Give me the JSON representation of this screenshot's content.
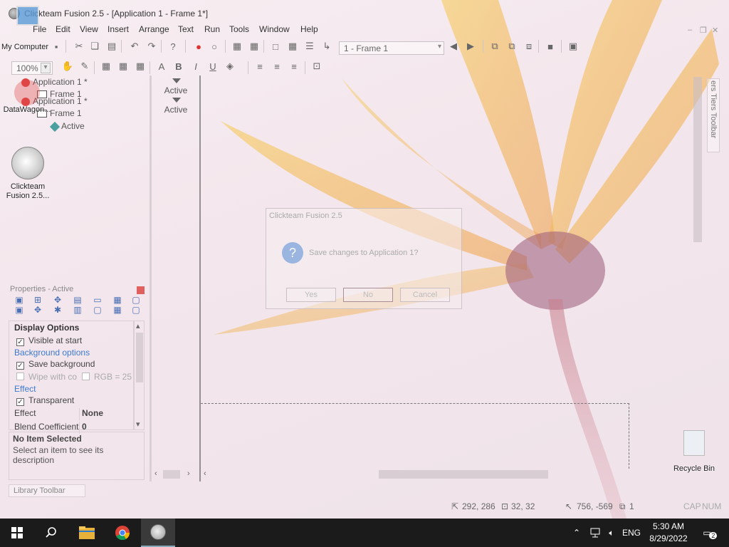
{
  "window": {
    "title": "Clickteam Fusion 2.5 - [Application 1 - Frame 1*]"
  },
  "menu": [
    "File",
    "Edit",
    "View",
    "Insert",
    "Arrange",
    "Text",
    "Run",
    "Tools",
    "Window",
    "Help"
  ],
  "toolbar": {
    "frame_select": "1 - Frame 1",
    "zoom": "100%"
  },
  "workspace_tree": {
    "items": [
      {
        "label": "Application 1 *",
        "type": "app"
      },
      {
        "label": "Frame 1",
        "type": "frame"
      },
      {
        "label": "Application 1 *",
        "type": "app"
      },
      {
        "label": "Frame 1",
        "type": "frame"
      },
      {
        "label": "Active",
        "type": "active"
      }
    ]
  },
  "storyboard": {
    "labels": [
      "Active",
      "Active"
    ]
  },
  "side_tab": "ers Tiers Toolbar",
  "properties": {
    "header": "Properties - Active",
    "rows": [
      {
        "kind": "section",
        "label": "Display Options"
      },
      {
        "kind": "check",
        "label": "Visible at start",
        "checked": true
      },
      {
        "kind": "subsection",
        "label": "Background options"
      },
      {
        "kind": "check",
        "label": "Save background",
        "checked": true
      },
      {
        "kind": "check2",
        "label": "Wipe with co",
        "checked": false,
        "extra": "RGB = 25"
      },
      {
        "kind": "subsection",
        "label": "Effect"
      },
      {
        "kind": "check",
        "label": "Transparent",
        "checked": true
      },
      {
        "kind": "value",
        "label": "Effect",
        "value": "None"
      },
      {
        "kind": "value",
        "label": "Blend Coefficient",
        "value": "0"
      }
    ],
    "desc_title": "No Item Selected",
    "desc_text": "Select an item to see its description"
  },
  "library_tab": "Library Toolbar",
  "status": {
    "pos1": "292, 286",
    "size": "32, 32",
    "pos2": "756, -569",
    "layer": "1",
    "caps": "CAP",
    "num": "NUM"
  },
  "dialog": {
    "title": "Clickteam Fusion 2.5",
    "message": "Save changes to Application 1?",
    "buttons": [
      "Yes",
      "No",
      "Cancel"
    ]
  },
  "desktop_icons": [
    {
      "label": "My Computer"
    },
    {
      "label": "DataWagon..."
    },
    {
      "label": "Clickteam Fusion 2.5..."
    },
    {
      "label": "Recycle Bin"
    }
  ],
  "taskbar": {
    "language": "ENG",
    "time": "5:30 AM",
    "date": "8/29/2022",
    "notifications": "2"
  }
}
